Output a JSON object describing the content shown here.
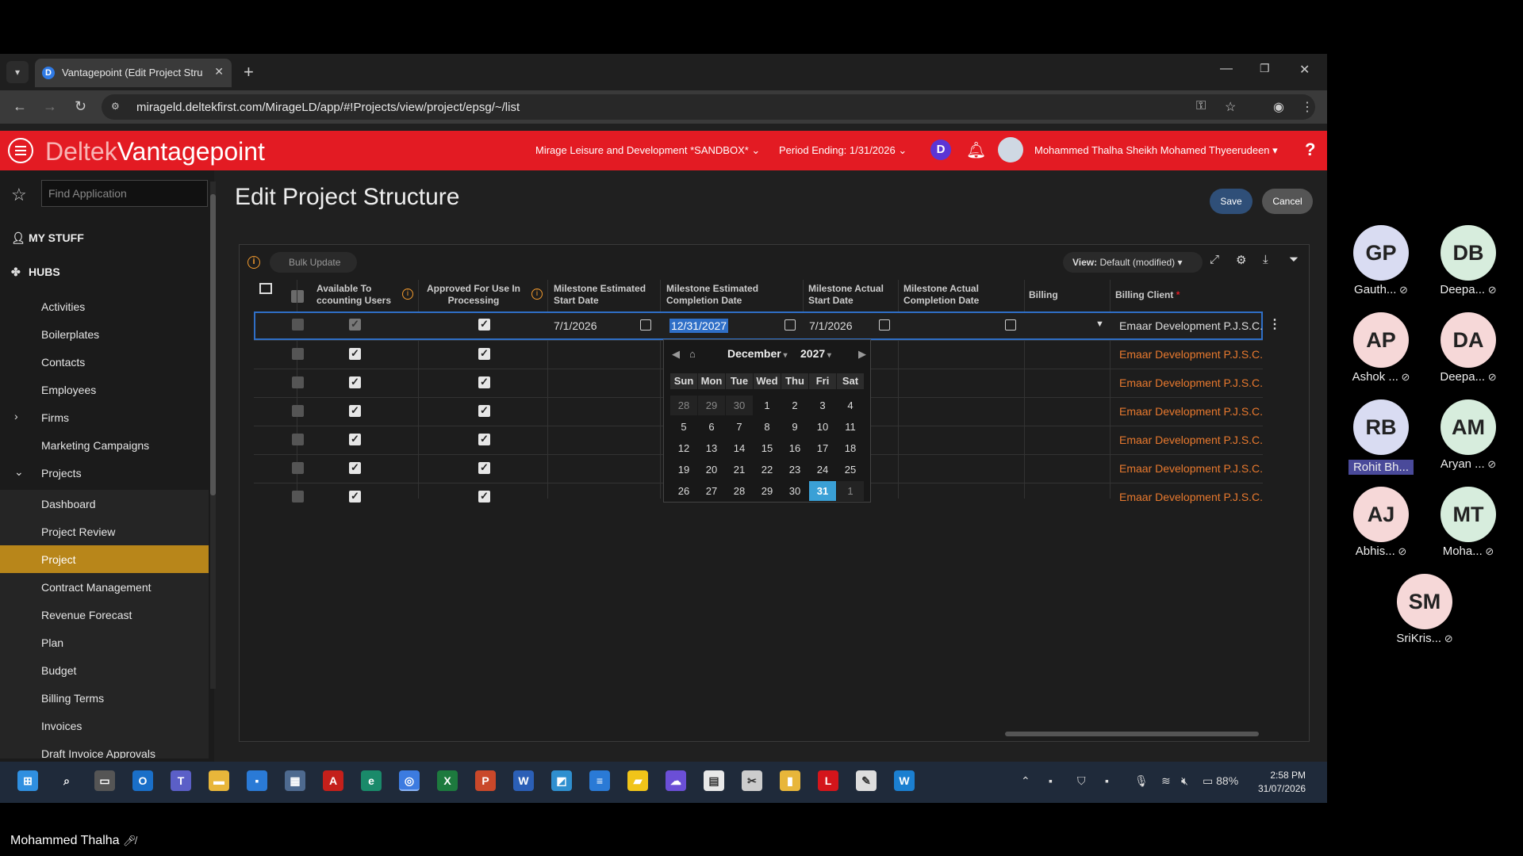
{
  "browser": {
    "tab_title": "Vantagepoint (Edit Project Stru",
    "url": "mirageld.deltekfirst.com/MirageLD/app/#!Projects/view/project/epsg/~/list",
    "favicon_letter": "D"
  },
  "app": {
    "logo_deltek": "Deltek",
    "logo_vantagepoint": "Vantagepoint",
    "company": "Mirage Leisure and Development *SANDBOX*",
    "period": "Period Ending: 1/31/2026",
    "badge_letter": "D",
    "user_name": "Mohammed Thalha Sheikh Mohamed Thyeerudeen"
  },
  "sidebar": {
    "find_placeholder": "Find Application",
    "sections": [
      "MY STUFF",
      "HUBS"
    ],
    "items": [
      {
        "label": "Activities"
      },
      {
        "label": "Boilerplates"
      },
      {
        "label": "Contacts"
      },
      {
        "label": "Employees"
      },
      {
        "label": "Firms"
      },
      {
        "label": "Marketing Campaigns"
      },
      {
        "label": "Projects"
      },
      {
        "label": "Dashboard"
      },
      {
        "label": "Project Review"
      },
      {
        "label": "Project"
      },
      {
        "label": "Contract Management"
      },
      {
        "label": "Revenue Forecast"
      },
      {
        "label": "Plan"
      },
      {
        "label": "Budget"
      },
      {
        "label": "Billing Terms"
      },
      {
        "label": "Invoices"
      },
      {
        "label": "Draft Invoice Approvals"
      }
    ]
  },
  "page": {
    "title": "Edit Project Structure",
    "save_label": "Save",
    "cancel_label": "Cancel",
    "bulk_update": "Bulk Update",
    "view_prefix": "View:",
    "view_value": "Default (modified)"
  },
  "grid": {
    "columns": {
      "available_l1": "Available To",
      "available_l2": "ccounting Users",
      "approved_l1": "Approved For Use In",
      "approved_l2": "Processing",
      "mes_start_l1": "Milestone Estimated",
      "mes_start_l2": "Start Date",
      "mes_comp_l1": "Milestone Estimated",
      "mes_comp_l2": "Completion Date",
      "mas_start_l1": "Milestone Actual",
      "mas_start_l2": "Start Date",
      "mas_comp_l1": "Milestone Actual",
      "mas_comp_l2": "Completion Date",
      "billing": "Billing",
      "billing_client": "Billing Client",
      "required_mark": "*"
    },
    "first_row": {
      "est_start": "7/1/2026",
      "est_completion": "12/31/2027",
      "act_start": "7/1/2026"
    },
    "billing_client": "Emaar Development P.J.S.C."
  },
  "calendar": {
    "month": "December",
    "year": "2027",
    "dow": [
      "Sun",
      "Mon",
      "Tue",
      "Wed",
      "Thu",
      "Fri",
      "Sat"
    ],
    "weeks": [
      [
        "28",
        "29",
        "30",
        "1",
        "2",
        "3",
        "4"
      ],
      [
        "5",
        "6",
        "7",
        "8",
        "9",
        "10",
        "11"
      ],
      [
        "12",
        "13",
        "14",
        "15",
        "16",
        "17",
        "18"
      ],
      [
        "19",
        "20",
        "21",
        "22",
        "23",
        "24",
        "25"
      ],
      [
        "26",
        "27",
        "28",
        "29",
        "30",
        "31",
        "1"
      ]
    ],
    "selected": "31"
  },
  "taskbar": {
    "battery": "88%",
    "time": "2:58 PM",
    "date": "31/07/2026"
  },
  "participants": [
    {
      "initials": "GP",
      "name": "Gauth...",
      "color": "#d9dcf2"
    },
    {
      "initials": "DB",
      "name": "Deepa...",
      "color": "#d7eddd"
    },
    {
      "initials": "AP",
      "name": "Ashok ...",
      "color": "#f6d8d8"
    },
    {
      "initials": "DA",
      "name": "Deepa...",
      "color": "#f6d8d8"
    },
    {
      "initials": "RB",
      "name": "Rohit Bh...",
      "color": "#d9dcf2"
    },
    {
      "initials": "AM",
      "name": "Aryan ...",
      "color": "#d7eddd"
    },
    {
      "initials": "AJ",
      "name": "Abhis...",
      "color": "#f6d8d8"
    },
    {
      "initials": "MT",
      "name": "Moha...",
      "color": "#d7eddd"
    },
    {
      "initials": "SM",
      "name": "SriKris...",
      "color": "#f6d8d8"
    }
  ],
  "self_name": "Mohammed Thalha"
}
